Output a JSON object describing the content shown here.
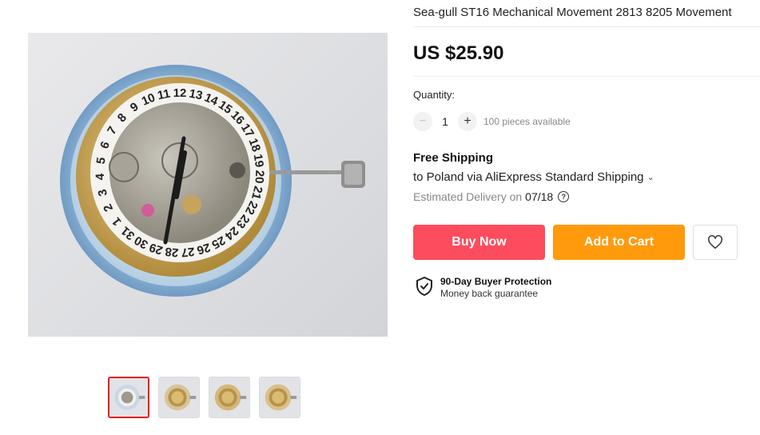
{
  "product": {
    "title": "Sea-gull ST16 Mechanical Movement 2813 8205 Movement",
    "price": "US $25.90"
  },
  "gallery": {
    "thumbnails": [
      {
        "label": "thumb-1",
        "selected": true
      },
      {
        "label": "thumb-2",
        "selected": false
      },
      {
        "label": "thumb-3",
        "selected": false
      },
      {
        "label": "thumb-4",
        "selected": false
      }
    ],
    "dial_numbers": [
      "12",
      "11",
      "10",
      "9",
      "8",
      "7",
      "6",
      "5",
      "4",
      "3",
      "2",
      "1",
      "31",
      "30",
      "29",
      "28",
      "27",
      "26",
      "25",
      "24",
      "23",
      "22",
      "21",
      "20",
      "19",
      "18",
      "17",
      "16",
      "15",
      "14",
      "13"
    ]
  },
  "quantity": {
    "label": "Quantity:",
    "minus": "−",
    "value": "1",
    "plus": "+",
    "available": "100 pieces available"
  },
  "shipping": {
    "title": "Free Shipping",
    "detail": "to Poland via AliExpress Standard Shipping",
    "chevron": "⌄",
    "delivery_label": "Estimated Delivery on",
    "delivery_date": "07/18",
    "help_icon": "?"
  },
  "actions": {
    "buy_now": "Buy Now",
    "add_to_cart": "Add to Cart",
    "wishlist_icon": "heart-icon"
  },
  "protection": {
    "title": "90-Day Buyer Protection",
    "subtitle": "Money back guarantee"
  },
  "colors": {
    "buy_now": "#fd4c5d",
    "add_to_cart": "#ff9a0d",
    "thumb_selected_border": "#e02020"
  }
}
